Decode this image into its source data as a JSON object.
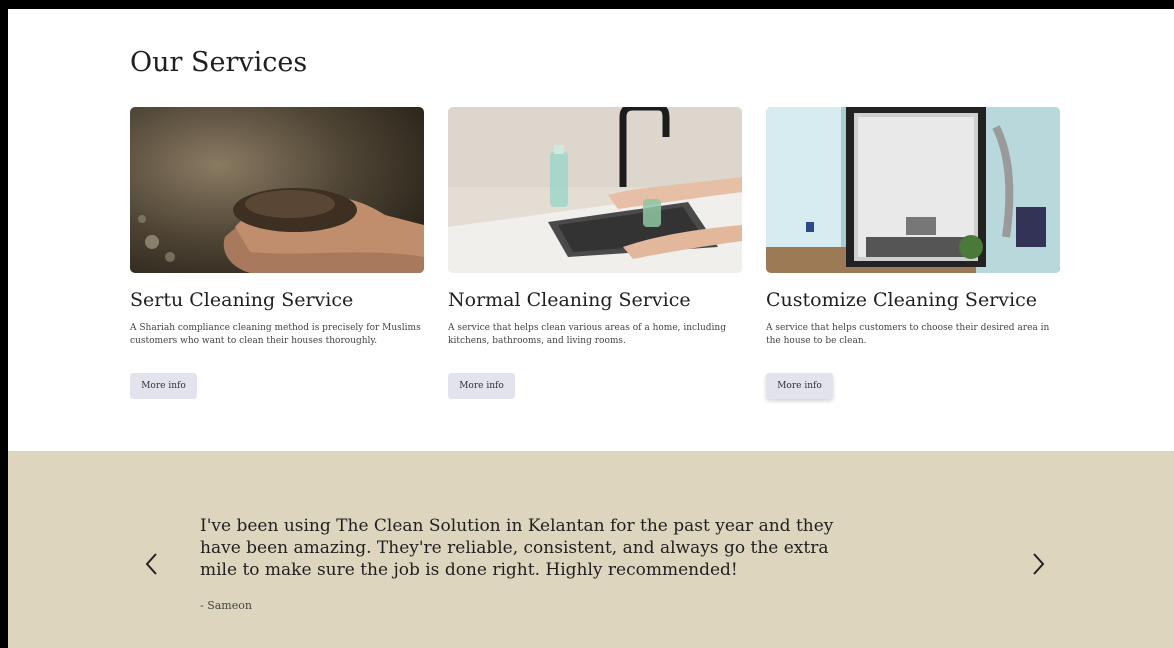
{
  "services": {
    "title": "Our Services",
    "cards": [
      {
        "image": "hands-holding-soil",
        "title": "Sertu Cleaning Service",
        "description": "A Shariah compliance cleaning method is precisely for Muslims customers who want to clean their houses thoroughly.",
        "button": "More info"
      },
      {
        "image": "person-cleaning-kitchen-sink",
        "title": "Normal Cleaning Service",
        "description": "A service that helps clean various areas of a home, including kitchens, bathrooms, and living rooms.",
        "button": "More info"
      },
      {
        "image": "grow-tent-in-room",
        "title": "Customize Cleaning Service",
        "description": "A service that helps customers to choose their desired area in the house to be clean.",
        "button": "More info"
      }
    ]
  },
  "testimonial": {
    "quote": "I've been using The Clean Solution in Kelantan for the past year and they have been amazing. They're reliable, consistent, and always go the extra mile to make sure the job is done right. Highly recommended!",
    "author": "- Sameon",
    "prev_icon": "chevron-left-icon",
    "next_icon": "chevron-right-icon"
  },
  "colors": {
    "testimonial_bg": "#ddd5be",
    "button_bg": "#e3e3ed"
  }
}
